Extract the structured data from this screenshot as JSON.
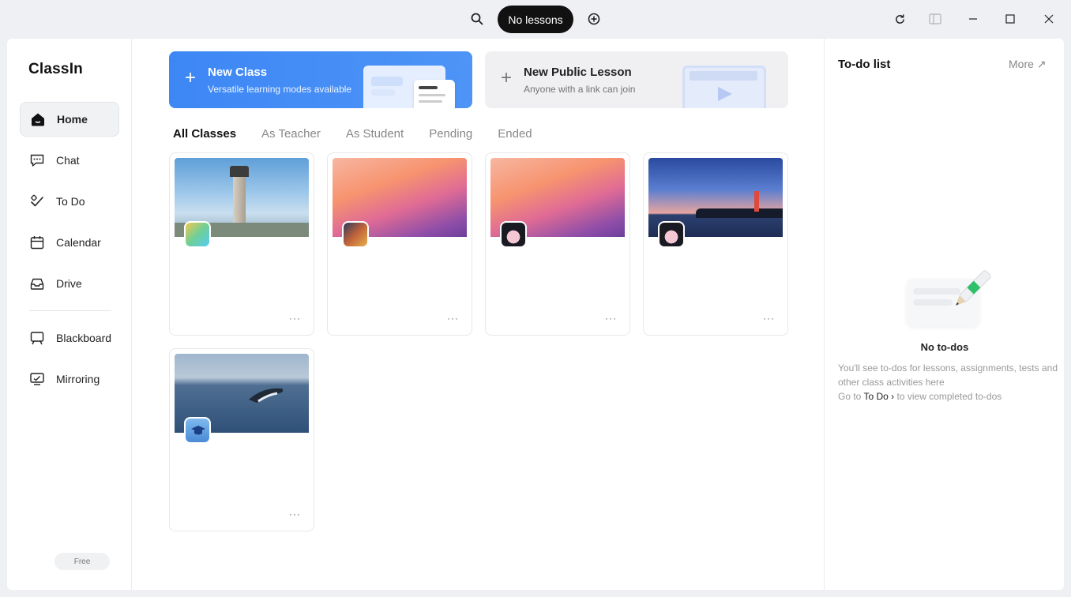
{
  "topbar": {
    "search_icon": "search-icon",
    "lesson_pill": "No lessons",
    "add_icon": "add-circle-icon",
    "window_controls": [
      "refresh-icon",
      "sidebar-toggle-icon",
      "minimize-icon",
      "maximize-icon",
      "close-icon"
    ]
  },
  "sidebar": {
    "logo": "ClassIn",
    "items": [
      {
        "label": "Home",
        "icon": "home-icon",
        "active": true
      },
      {
        "label": "Chat",
        "icon": "chat-icon"
      },
      {
        "label": "To Do",
        "icon": "todo-icon"
      },
      {
        "label": "Calendar",
        "icon": "calendar-icon"
      },
      {
        "label": "Drive",
        "icon": "drive-icon"
      },
      {
        "label": "Blackboard",
        "icon": "blackboard-icon"
      },
      {
        "label": "Mirroring",
        "icon": "mirroring-icon"
      }
    ],
    "plan_badge": "Free"
  },
  "banners": {
    "new_class": {
      "title": "New Class",
      "subtitle": "Versatile learning modes available",
      "plus": "+"
    },
    "public_lesson": {
      "title": "New Public Lesson",
      "subtitle": "Anyone with a link can join",
      "plus": "+"
    }
  },
  "tabs": [
    {
      "label": "All Classes",
      "active": true
    },
    {
      "label": "As Teacher"
    },
    {
      "label": "As Student"
    },
    {
      "label": "Pending"
    },
    {
      "label": "Ended"
    }
  ],
  "classes": [
    {
      "thumb": "lighthouse-sky",
      "avatar": "cartoon-avatar",
      "more": "···"
    },
    {
      "thumb": "gradient-sunset",
      "avatar": "characters-avatar",
      "more": "···"
    },
    {
      "thumb": "gradient-sunset",
      "avatar": "girl-avatar",
      "more": "···"
    },
    {
      "thumb": "lighthouse-dusk",
      "avatar": "girl-avatar",
      "more": "···"
    },
    {
      "thumb": "whale-ocean",
      "avatar": "graduation-cap-avatar",
      "more": "···"
    }
  ],
  "todo_panel": {
    "title": "To-do list",
    "more": "More ↗",
    "empty_title": "No to-dos",
    "empty_line1": "You'll see to-dos for lessons, assignments, tests and other class activities here",
    "empty_line2_prefix": "Go to ",
    "empty_link": "To Do",
    "empty_line2_suffix": " to view completed to-dos"
  },
  "colors": {
    "accent_blue": "#3d87f5",
    "pill_black": "#111111",
    "pen_green": "#2fc06a"
  }
}
